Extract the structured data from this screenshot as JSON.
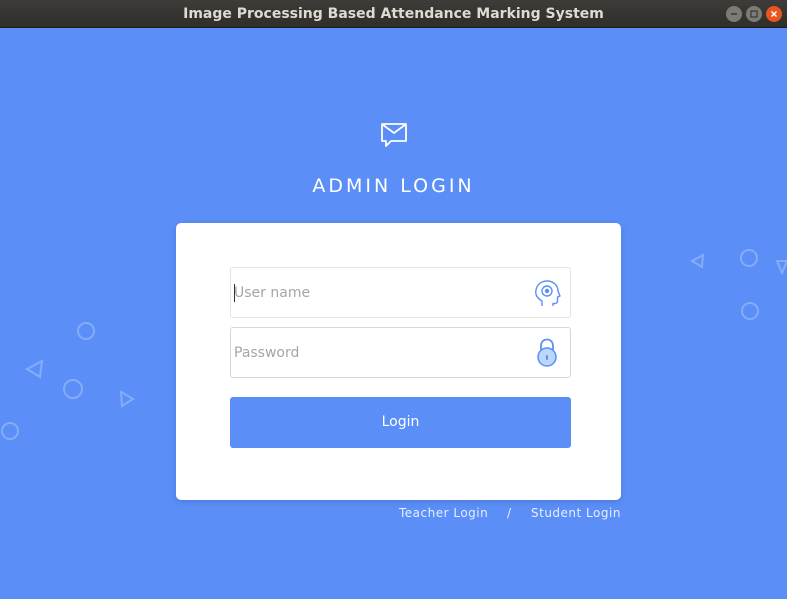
{
  "window": {
    "title": "Image Processing Based Attendance Marking System"
  },
  "header": {
    "icon": "mail-icon",
    "title": "ADMIN LOGIN"
  },
  "form": {
    "username": {
      "value": "",
      "placeholder": "User name",
      "icon": "user-head-icon"
    },
    "password": {
      "value": "",
      "placeholder": "Password",
      "icon": "padlock-icon"
    },
    "login_label": "Login"
  },
  "footer_links": {
    "teacher": "Teacher Login",
    "separator": "/",
    "student": "Student Login"
  },
  "colors": {
    "background": "#5b8ff7",
    "button": "#5b8ff7",
    "card": "#ffffff",
    "close_button": "#e95420"
  }
}
